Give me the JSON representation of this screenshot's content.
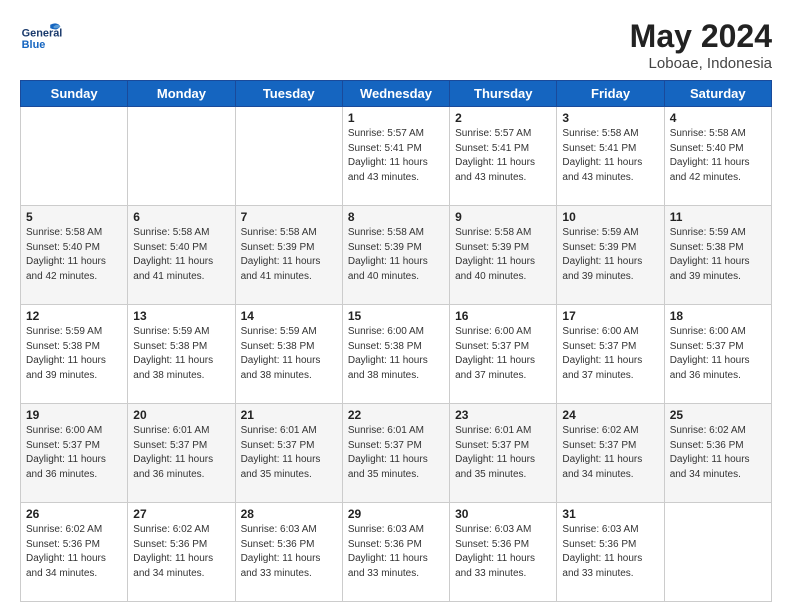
{
  "header": {
    "logo_general": "General",
    "logo_blue": "Blue",
    "month_title": "May 2024",
    "subtitle": "Loboae, Indonesia"
  },
  "days_of_week": [
    "Sunday",
    "Monday",
    "Tuesday",
    "Wednesday",
    "Thursday",
    "Friday",
    "Saturday"
  ],
  "weeks": [
    [
      {
        "day": "",
        "info": ""
      },
      {
        "day": "",
        "info": ""
      },
      {
        "day": "",
        "info": ""
      },
      {
        "day": "1",
        "info": "Sunrise: 5:57 AM\nSunset: 5:41 PM\nDaylight: 11 hours\nand 43 minutes."
      },
      {
        "day": "2",
        "info": "Sunrise: 5:57 AM\nSunset: 5:41 PM\nDaylight: 11 hours\nand 43 minutes."
      },
      {
        "day": "3",
        "info": "Sunrise: 5:58 AM\nSunset: 5:41 PM\nDaylight: 11 hours\nand 43 minutes."
      },
      {
        "day": "4",
        "info": "Sunrise: 5:58 AM\nSunset: 5:40 PM\nDaylight: 11 hours\nand 42 minutes."
      }
    ],
    [
      {
        "day": "5",
        "info": "Sunrise: 5:58 AM\nSunset: 5:40 PM\nDaylight: 11 hours\nand 42 minutes."
      },
      {
        "day": "6",
        "info": "Sunrise: 5:58 AM\nSunset: 5:40 PM\nDaylight: 11 hours\nand 41 minutes."
      },
      {
        "day": "7",
        "info": "Sunrise: 5:58 AM\nSunset: 5:39 PM\nDaylight: 11 hours\nand 41 minutes."
      },
      {
        "day": "8",
        "info": "Sunrise: 5:58 AM\nSunset: 5:39 PM\nDaylight: 11 hours\nand 40 minutes."
      },
      {
        "day": "9",
        "info": "Sunrise: 5:58 AM\nSunset: 5:39 PM\nDaylight: 11 hours\nand 40 minutes."
      },
      {
        "day": "10",
        "info": "Sunrise: 5:59 AM\nSunset: 5:39 PM\nDaylight: 11 hours\nand 39 minutes."
      },
      {
        "day": "11",
        "info": "Sunrise: 5:59 AM\nSunset: 5:38 PM\nDaylight: 11 hours\nand 39 minutes."
      }
    ],
    [
      {
        "day": "12",
        "info": "Sunrise: 5:59 AM\nSunset: 5:38 PM\nDaylight: 11 hours\nand 39 minutes."
      },
      {
        "day": "13",
        "info": "Sunrise: 5:59 AM\nSunset: 5:38 PM\nDaylight: 11 hours\nand 38 minutes."
      },
      {
        "day": "14",
        "info": "Sunrise: 5:59 AM\nSunset: 5:38 PM\nDaylight: 11 hours\nand 38 minutes."
      },
      {
        "day": "15",
        "info": "Sunrise: 6:00 AM\nSunset: 5:38 PM\nDaylight: 11 hours\nand 38 minutes."
      },
      {
        "day": "16",
        "info": "Sunrise: 6:00 AM\nSunset: 5:37 PM\nDaylight: 11 hours\nand 37 minutes."
      },
      {
        "day": "17",
        "info": "Sunrise: 6:00 AM\nSunset: 5:37 PM\nDaylight: 11 hours\nand 37 minutes."
      },
      {
        "day": "18",
        "info": "Sunrise: 6:00 AM\nSunset: 5:37 PM\nDaylight: 11 hours\nand 36 minutes."
      }
    ],
    [
      {
        "day": "19",
        "info": "Sunrise: 6:00 AM\nSunset: 5:37 PM\nDaylight: 11 hours\nand 36 minutes."
      },
      {
        "day": "20",
        "info": "Sunrise: 6:01 AM\nSunset: 5:37 PM\nDaylight: 11 hours\nand 36 minutes."
      },
      {
        "day": "21",
        "info": "Sunrise: 6:01 AM\nSunset: 5:37 PM\nDaylight: 11 hours\nand 35 minutes."
      },
      {
        "day": "22",
        "info": "Sunrise: 6:01 AM\nSunset: 5:37 PM\nDaylight: 11 hours\nand 35 minutes."
      },
      {
        "day": "23",
        "info": "Sunrise: 6:01 AM\nSunset: 5:37 PM\nDaylight: 11 hours\nand 35 minutes."
      },
      {
        "day": "24",
        "info": "Sunrise: 6:02 AM\nSunset: 5:37 PM\nDaylight: 11 hours\nand 34 minutes."
      },
      {
        "day": "25",
        "info": "Sunrise: 6:02 AM\nSunset: 5:36 PM\nDaylight: 11 hours\nand 34 minutes."
      }
    ],
    [
      {
        "day": "26",
        "info": "Sunrise: 6:02 AM\nSunset: 5:36 PM\nDaylight: 11 hours\nand 34 minutes."
      },
      {
        "day": "27",
        "info": "Sunrise: 6:02 AM\nSunset: 5:36 PM\nDaylight: 11 hours\nand 34 minutes."
      },
      {
        "day": "28",
        "info": "Sunrise: 6:03 AM\nSunset: 5:36 PM\nDaylight: 11 hours\nand 33 minutes."
      },
      {
        "day": "29",
        "info": "Sunrise: 6:03 AM\nSunset: 5:36 PM\nDaylight: 11 hours\nand 33 minutes."
      },
      {
        "day": "30",
        "info": "Sunrise: 6:03 AM\nSunset: 5:36 PM\nDaylight: 11 hours\nand 33 minutes."
      },
      {
        "day": "31",
        "info": "Sunrise: 6:03 AM\nSunset: 5:36 PM\nDaylight: 11 hours\nand 33 minutes."
      },
      {
        "day": "",
        "info": ""
      }
    ]
  ],
  "alt_row_indices": [
    1,
    3
  ]
}
